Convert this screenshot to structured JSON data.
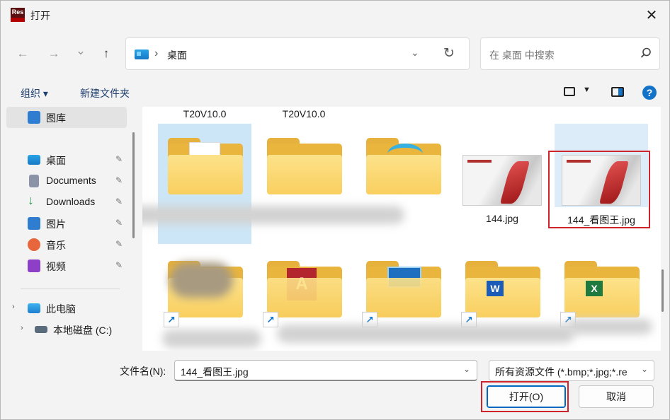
{
  "window": {
    "title": "打开",
    "logo_text": "Res",
    "close_glyph": "✕"
  },
  "nav": {
    "back_glyph": "←",
    "forward_glyph": "→",
    "recent_glyph": "⌄",
    "up_glyph": "↑",
    "address_chevron": "›",
    "address_text": "桌面",
    "address_dropdown_glyph": "⌄",
    "refresh_glyph": "↻",
    "search_placeholder": "在 桌面 中搜索"
  },
  "toolbar": {
    "organize_label": "组织 ▾",
    "new_folder_label": "新建文件夹",
    "view_dropdown_glyph": "▼",
    "help_label": "?"
  },
  "sidebar": {
    "items": [
      {
        "label": "图库",
        "icon": "gallery-icon"
      },
      {
        "label": "桌面",
        "icon": "desktop-icon",
        "pinned": true
      },
      {
        "label": "Documents",
        "icon": "documents-icon",
        "pinned": true
      },
      {
        "label": "Downloads",
        "icon": "downloads-icon",
        "pinned": true
      },
      {
        "label": "图片",
        "icon": "pictures-icon",
        "pinned": true
      },
      {
        "label": "音乐",
        "icon": "music-icon",
        "pinned": true
      },
      {
        "label": "视频",
        "icon": "videos-icon",
        "pinned": true
      },
      {
        "label": "此电脑",
        "icon": "this-pc-icon"
      },
      {
        "label": "本地磁盘 (C:)",
        "icon": "local-disk-icon"
      }
    ],
    "pin_glyph": "📌",
    "expand_glyph": "›"
  },
  "files": {
    "top_row_labels": [
      "T20V10.0",
      "T20V10.0"
    ],
    "items": [
      {
        "name": "",
        "type": "folder-doc"
      },
      {
        "name": "",
        "type": "folder"
      },
      {
        "name": "",
        "type": "folder-ie"
      },
      {
        "name": "144.jpg",
        "type": "image"
      },
      {
        "name": "144_看图王.jpg",
        "type": "image"
      }
    ],
    "shortcut_glyph": "↗",
    "app_glyph_a": "A",
    "app_glyph_w": "W",
    "app_glyph_x": "X"
  },
  "bottom": {
    "filename_label": "文件名(N):",
    "filename_value": "144_看图王.jpg",
    "filetype_value": "所有资源文件 (*.bmp;*.jpg;*.re",
    "dropdown_glyph": "⌄",
    "open_label": "打开(O)",
    "cancel_label": "取消"
  },
  "colors": {
    "accent": "#0067c0",
    "highlight_red": "#d0242c",
    "folder_yellow": "#f9cf5f"
  }
}
